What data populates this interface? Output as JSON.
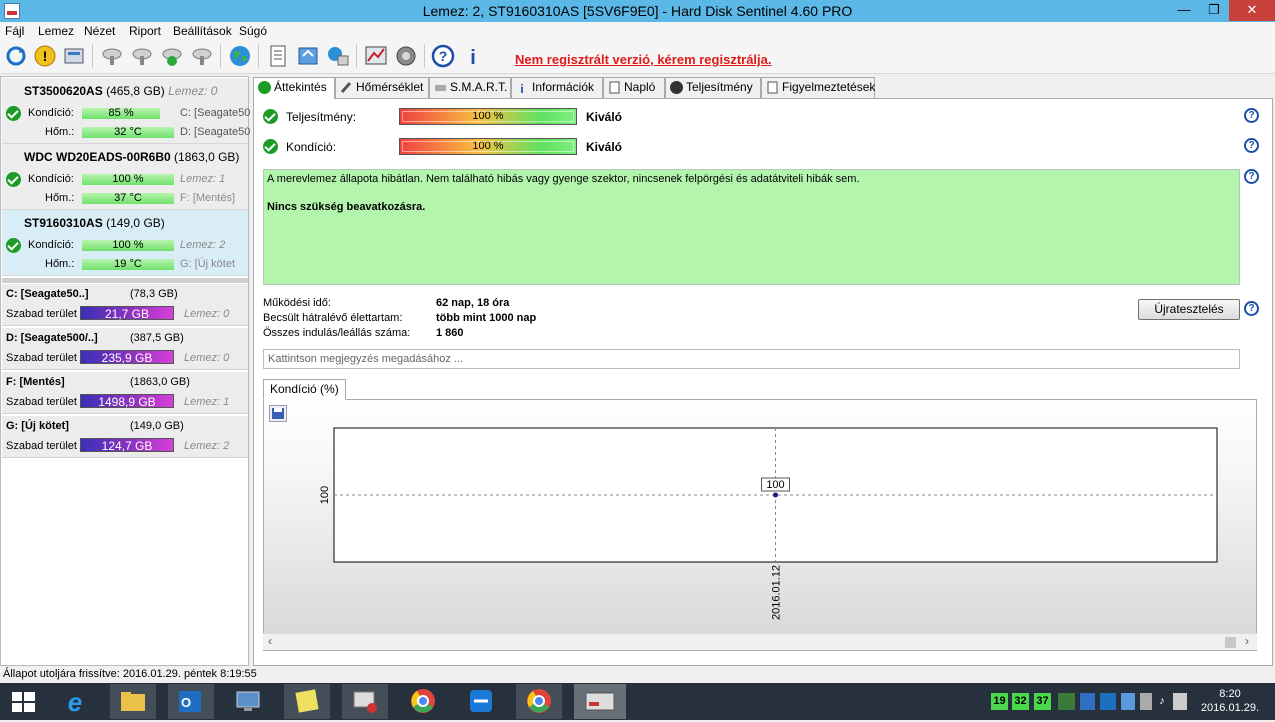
{
  "window": {
    "title": "Lemez: 2, ST9160310AS [5SV6F9E0]  -  Hard Disk Sentinel 4.60 PRO"
  },
  "menu": [
    "Fájl",
    "Lemez",
    "Nézet",
    "Riport",
    "Beállítások",
    "Súgó"
  ],
  "toolbar": {
    "unregistered": "Nem regisztrált verzió, kérem regisztrálja."
  },
  "disks": [
    {
      "name": "ST3500620AS",
      "size": "(465,8 GB)",
      "lemez": "Lemez: 0",
      "kondicio_label": "Kondíció:",
      "kondicio": "85 %",
      "kondicio_pct": 85,
      "side1": "C: [Seagate50",
      "hom_label": "Hőm.:",
      "hom": "32 °C",
      "side2": "D: [Seagate50"
    },
    {
      "name": "WDC WD20EADS-00R6B0",
      "size": "(1863,0 GB)",
      "lemez": "",
      "kondicio_label": "Kondíció:",
      "kondicio": "100 %",
      "kondicio_pct": 100,
      "side1": "Lemez: 1",
      "hom_label": "Hőm.:",
      "hom": "37 °C",
      "side2": "F: [Mentés]"
    },
    {
      "name": "ST9160310AS",
      "size": "(149,0 GB)",
      "lemez": "",
      "kondicio_label": "Kondíció:",
      "kondicio": "100 %",
      "kondicio_pct": 100,
      "side1": "Lemez: 2",
      "hom_label": "Hőm.:",
      "hom": "19 °C",
      "side2": "G: [Új kötet"
    }
  ],
  "partitions": [
    {
      "name": "C: [Seagate50..]",
      "size": "(78,3 GB)",
      "label": "Szabad terület",
      "free": "21,7 GB",
      "free_fraction": 0.28,
      "lemez": "Lemez: 0"
    },
    {
      "name": "D: [Seagate500/..]",
      "size": "(387,5 GB)",
      "label": "Szabad terület",
      "free": "235,9 GB",
      "free_fraction": 0.61,
      "lemez": "Lemez: 0"
    },
    {
      "name": "F: [Mentés]",
      "size": "(1863,0 GB)",
      "label": "Szabad terület",
      "free": "1498,9 GB",
      "free_fraction": 0.8,
      "lemez": "Lemez: 1"
    },
    {
      "name": "G: [Új kötet]",
      "size": "(149,0 GB)",
      "label": "Szabad terület",
      "free": "124,7 GB",
      "free_fraction": 0.84,
      "lemez": "Lemez: 2"
    }
  ],
  "tabs": [
    "Áttekintés",
    "Hőmérséklet",
    "S.M.A.R.T.",
    "Információk",
    "Napló",
    "Teljesítmény",
    "Figyelmeztetések"
  ],
  "overview": {
    "performance_label": "Teljesítmény:",
    "performance_value": "100 %",
    "performance_rating": "Kiváló",
    "condition_label": "Kondíció:",
    "condition_value": "100 %",
    "condition_rating": "Kiváló",
    "status_text": "A merevlemez állapota hibátlan. Nem található hibás vagy gyenge szektor, nincsenek felpörgési és adatátviteli hibák sem.",
    "status_action": "Nincs szükség beavatkozásra.",
    "uptime_label": "Működési idő:",
    "uptime_value": "62 nap, 18 óra",
    "lifetime_label": "Becsült hátralévő élettartam:",
    "lifetime_value": "több mint 1000 nap",
    "startstop_label": "Összes indulás/leállás száma:",
    "startstop_value": "1 860",
    "retest_button": "Újratesztelés",
    "note_placeholder": "Kattintson megjegyzés megadásához ...",
    "chart_tab": "Kondíció  (%)"
  },
  "chart_data": {
    "type": "line",
    "x": [
      "2016.01.12"
    ],
    "series": [
      {
        "values": [
          100
        ]
      }
    ],
    "data_labels": [
      "100"
    ],
    "y_tick": "100",
    "grid": true
  },
  "statusbar": "Állapot utoljára frissítve: 2016.01.29. péntek 8:19:55",
  "taskbar": {
    "tray_numbers": [
      "19",
      "32",
      "37"
    ],
    "time": "8:20",
    "date": "2016.01.29."
  }
}
